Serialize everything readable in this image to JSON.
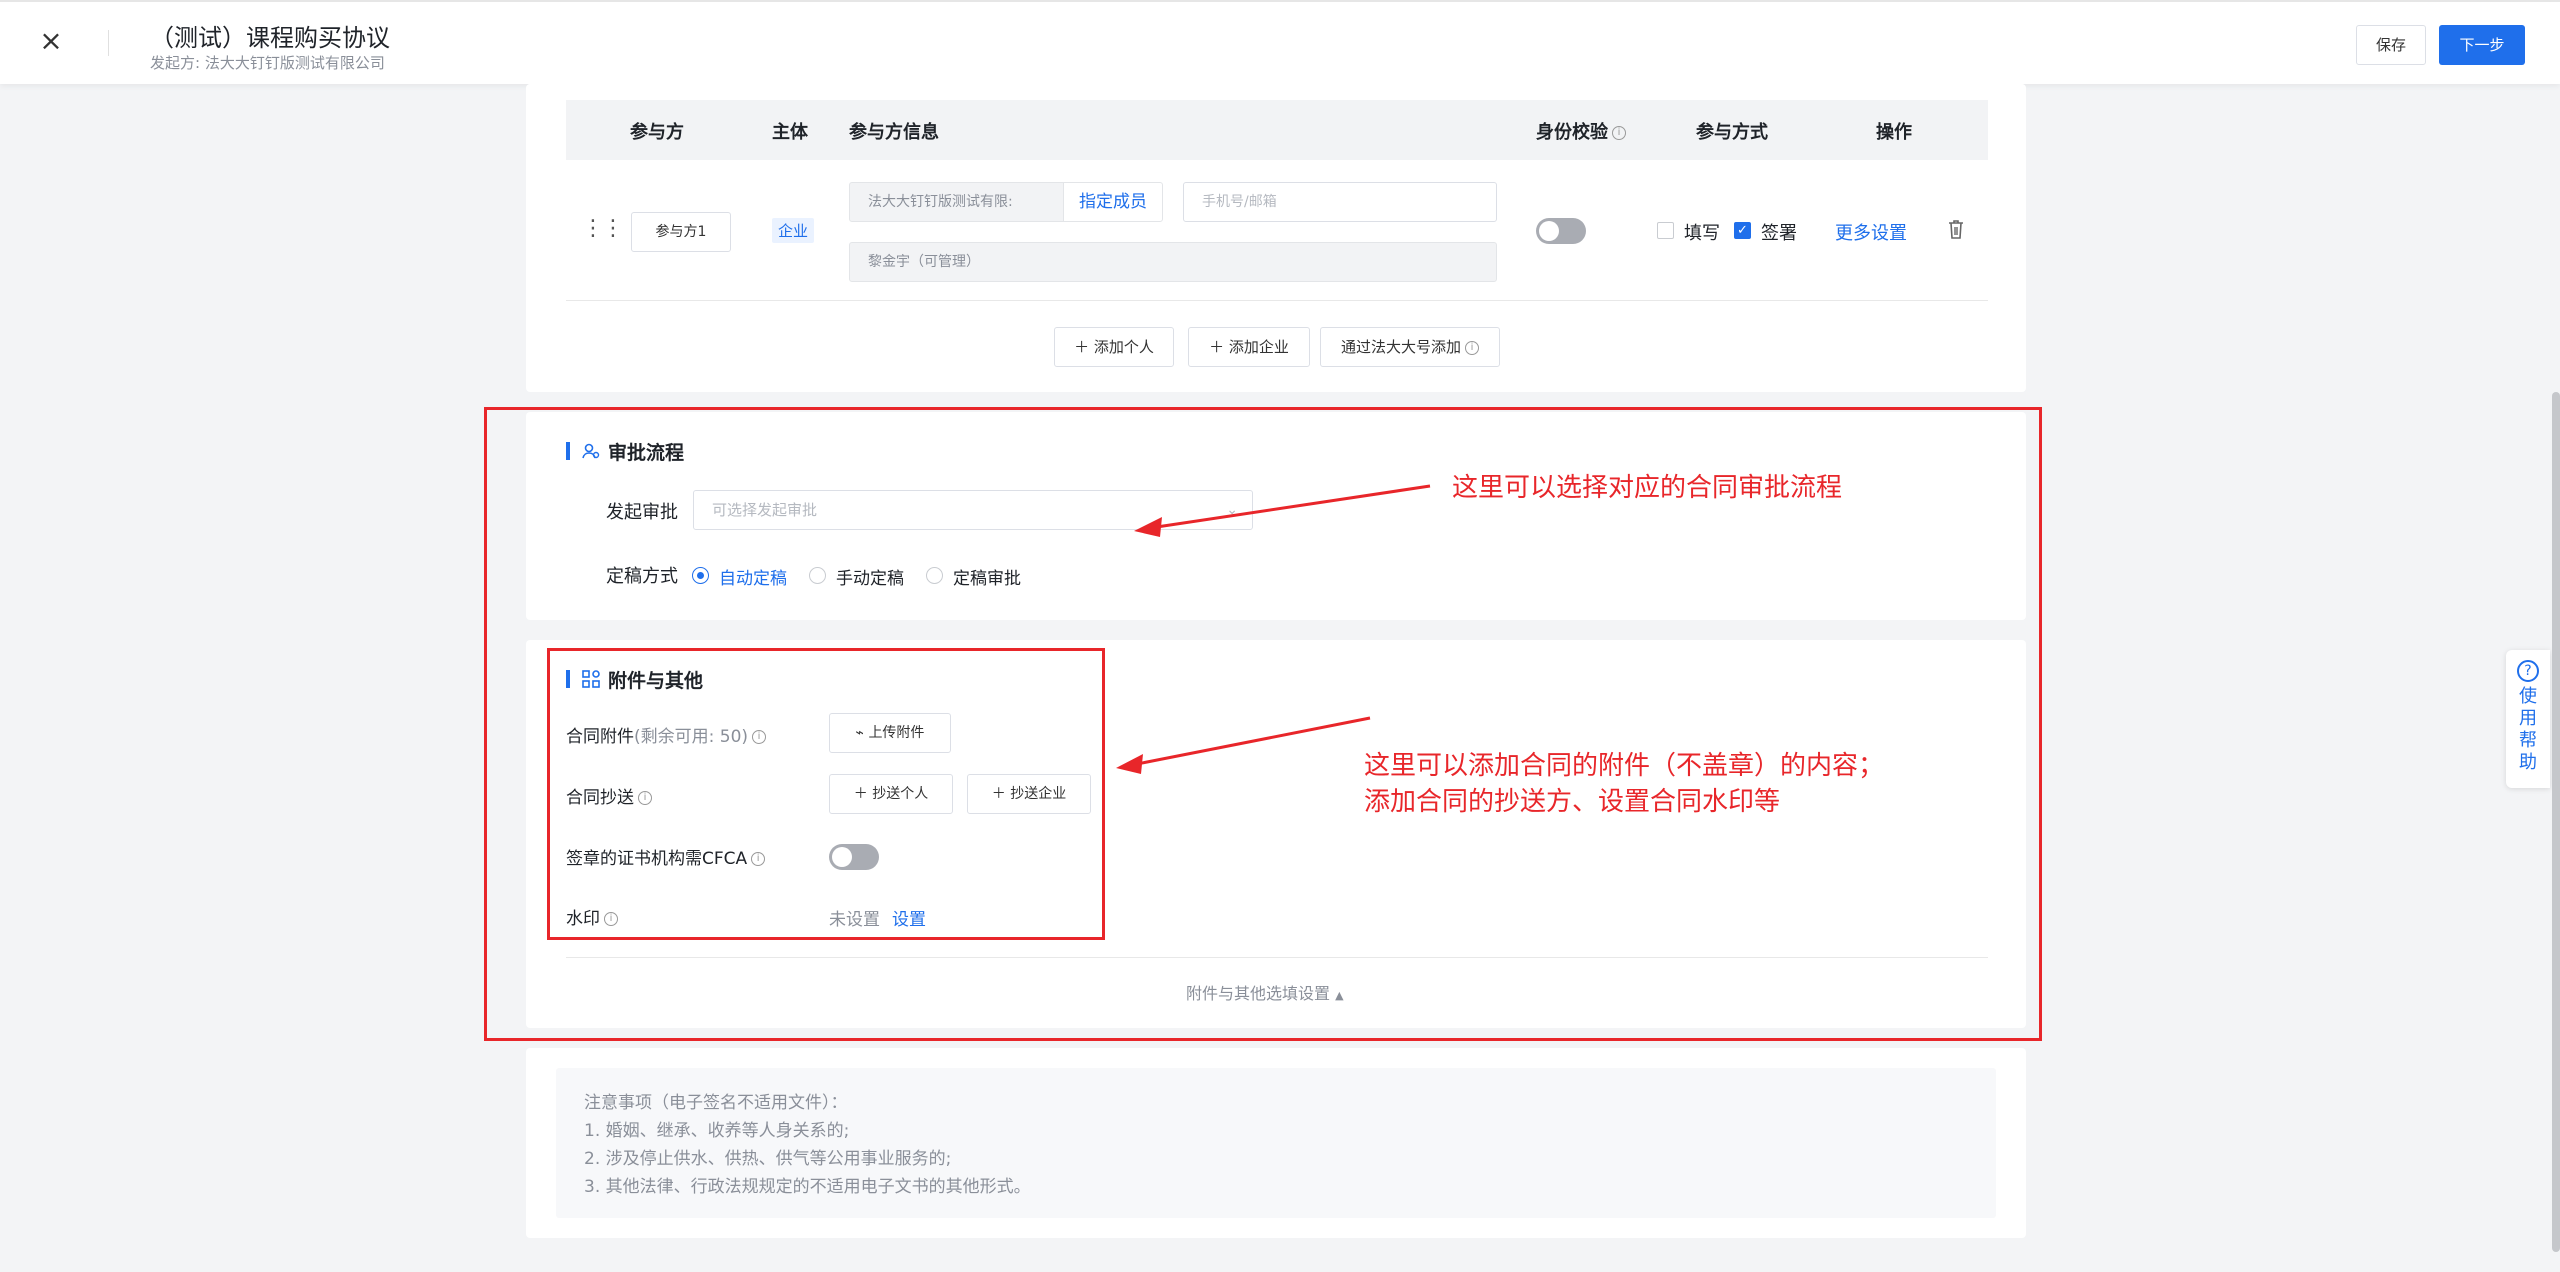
{
  "header": {
    "title": "（测试）课程购买协议",
    "initiator": "发起方: 法大大钉钉版测试有限公司",
    "save_label": "保存",
    "next_label": "下一步"
  },
  "participants": {
    "columns": [
      "参与方",
      "主体",
      "参与方信息",
      "身份校验",
      "参与方式",
      "操作"
    ],
    "row": {
      "role": "参与方1",
      "entity": "企业",
      "org_name": "法大大钉钉版测试有限:",
      "assign_label": "指定成员",
      "contact_placeholder": "手机号/邮箱",
      "member": "黎金宇（可管理）",
      "fill_label": "填写",
      "fill_checked": false,
      "sign_label": "签署",
      "sign_checked": true,
      "more_settings": "更多设置"
    },
    "add_person": "添加个人",
    "add_company": "添加企业",
    "add_by_account": "通过法大大号添加"
  },
  "approval": {
    "title": "审批流程",
    "initiate_label": "发起审批",
    "initiate_placeholder": "可选择发起审批",
    "finalize_label": "定稿方式",
    "options": [
      "自动定稿",
      "手动定稿",
      "定稿审批"
    ],
    "selected": "自动定稿"
  },
  "attachments": {
    "title": "附件与其他",
    "attach_label": "合同附件",
    "attach_remaining": "(剩余可用: 50)",
    "upload_label": "上传附件",
    "cc_label": "合同抄送",
    "cc_person": "抄送个人",
    "cc_company": "抄送企业",
    "cfca_label": "签章的证书机构需CFCA",
    "watermark_label": "水印",
    "watermark_status": "未设置",
    "watermark_set": "设置",
    "options_toggle": "附件与其他选填设置"
  },
  "notes": {
    "title": "注意事项（电子签名不适用文件）：",
    "items": [
      "1. 婚姻、继承、收养等人身关系的;",
      "2. 涉及停止供水、供热、供气等公用事业服务的;",
      "3. 其他法律、行政法规规定的不适用电子文书的其他形式。"
    ]
  },
  "annotations": {
    "approval_note": "这里可以选择对应的合同审批流程",
    "attach_note_line1": "这里可以添加合同的附件（不盖章）的内容；",
    "attach_note_line2": "添加合同的抄送方、设置合同水印等",
    "color": "#e8262a"
  },
  "help": {
    "label": "使用帮助"
  },
  "colors": {
    "accent": "#1f6feb",
    "background": "#f3f4f6"
  }
}
